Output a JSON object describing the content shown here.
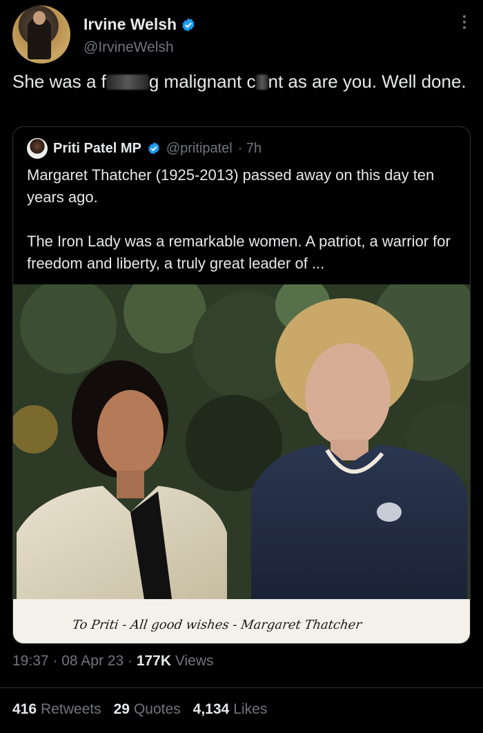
{
  "author": {
    "name": "Irvine Welsh",
    "handle": "@IrvineWelsh"
  },
  "tweet": {
    "part1": "She was a f",
    "part2": "g malignant c",
    "part3": "nt as are you. Well done."
  },
  "quote": {
    "name": "Priti Patel MP",
    "handle": "@pritipatel",
    "time": "· 7h",
    "paragraph1": "Margaret Thatcher (1925-2013) passed away on this day ten years ago.",
    "paragraph2": "The Iron Lady was a remarkable women. A patriot, a warrior for freedom and liberty, a truly great leader of ...",
    "photo_inscription": "To Priti - All good wishes - Margaret Thatcher"
  },
  "meta": {
    "time": "19:37",
    "date": "08 Apr 23",
    "views_count": "177K",
    "views_label": "Views"
  },
  "stats": {
    "retweets_count": "416",
    "retweets_label": "Retweets",
    "quotes_count": "29",
    "quotes_label": "Quotes",
    "likes_count": "4,134",
    "likes_label": "Likes"
  },
  "colors": {
    "background": "#000000",
    "text": "#e7e9ea",
    "muted": "#71767b",
    "verified": "#1d9bf0"
  }
}
